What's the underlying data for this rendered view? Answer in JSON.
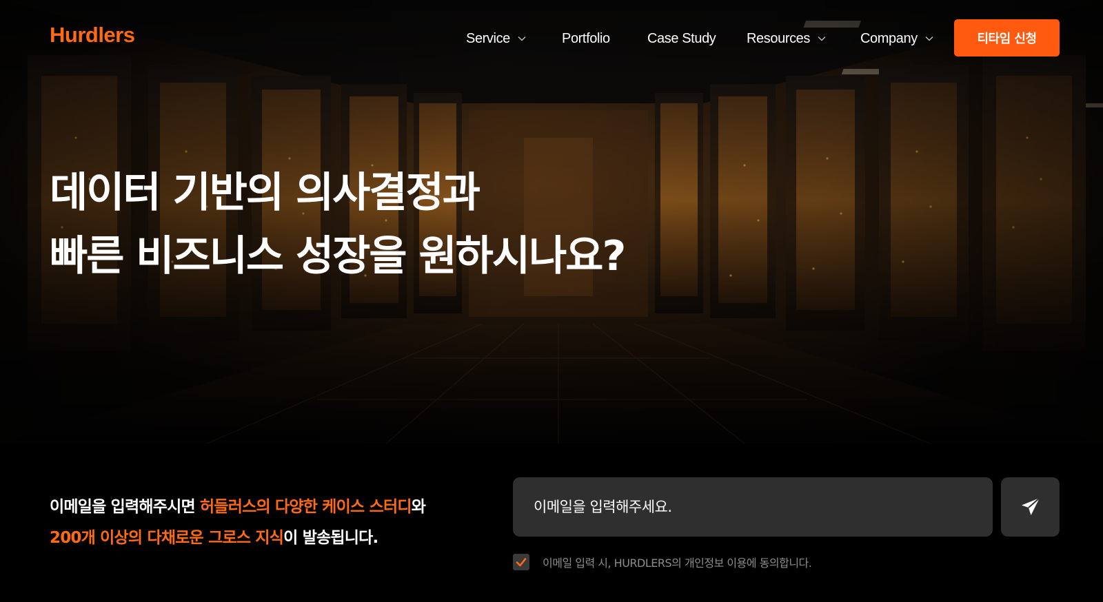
{
  "brand": {
    "logo_text": "Hurdlers",
    "accent_color": "#ff6a13"
  },
  "nav": {
    "items": [
      {
        "label": "Service",
        "has_dropdown": true,
        "icon": "chevron-down-icon"
      },
      {
        "label": "Portfolio",
        "has_dropdown": false
      },
      {
        "label": "Case Study",
        "has_dropdown": false
      },
      {
        "label": "Resources",
        "has_dropdown": true,
        "icon": "chevron-down-icon"
      },
      {
        "label": "Company",
        "has_dropdown": true,
        "icon": "chevron-down-icon"
      }
    ],
    "cta_label": "티타임 신청",
    "cta_color": "#ff5a10"
  },
  "hero": {
    "background": "data-center-server-racks-orange-lights",
    "headline_line1": "데이터 기반의 의사결정과",
    "headline_line2": "빠른 비즈니스 성장을 원하시나요?"
  },
  "subscribe": {
    "promo_line1_a": "이메일을 입력해주시면 ",
    "promo_line1_highlight": "허들러스의 다양한 케이스 스터디",
    "promo_line1_b": "와",
    "promo_line2_highlight": "200개 이상의 다채로운 그로스 지식",
    "promo_line2_b": "이 발송됩니다.",
    "email_placeholder": "이메일을 입력해주세요.",
    "email_value": "",
    "send_icon": "paper-plane-icon",
    "consent_checked": true,
    "consent_label": "이메일 입력 시, HURDLERS의 개인정보 이용에 동의합니다."
  }
}
